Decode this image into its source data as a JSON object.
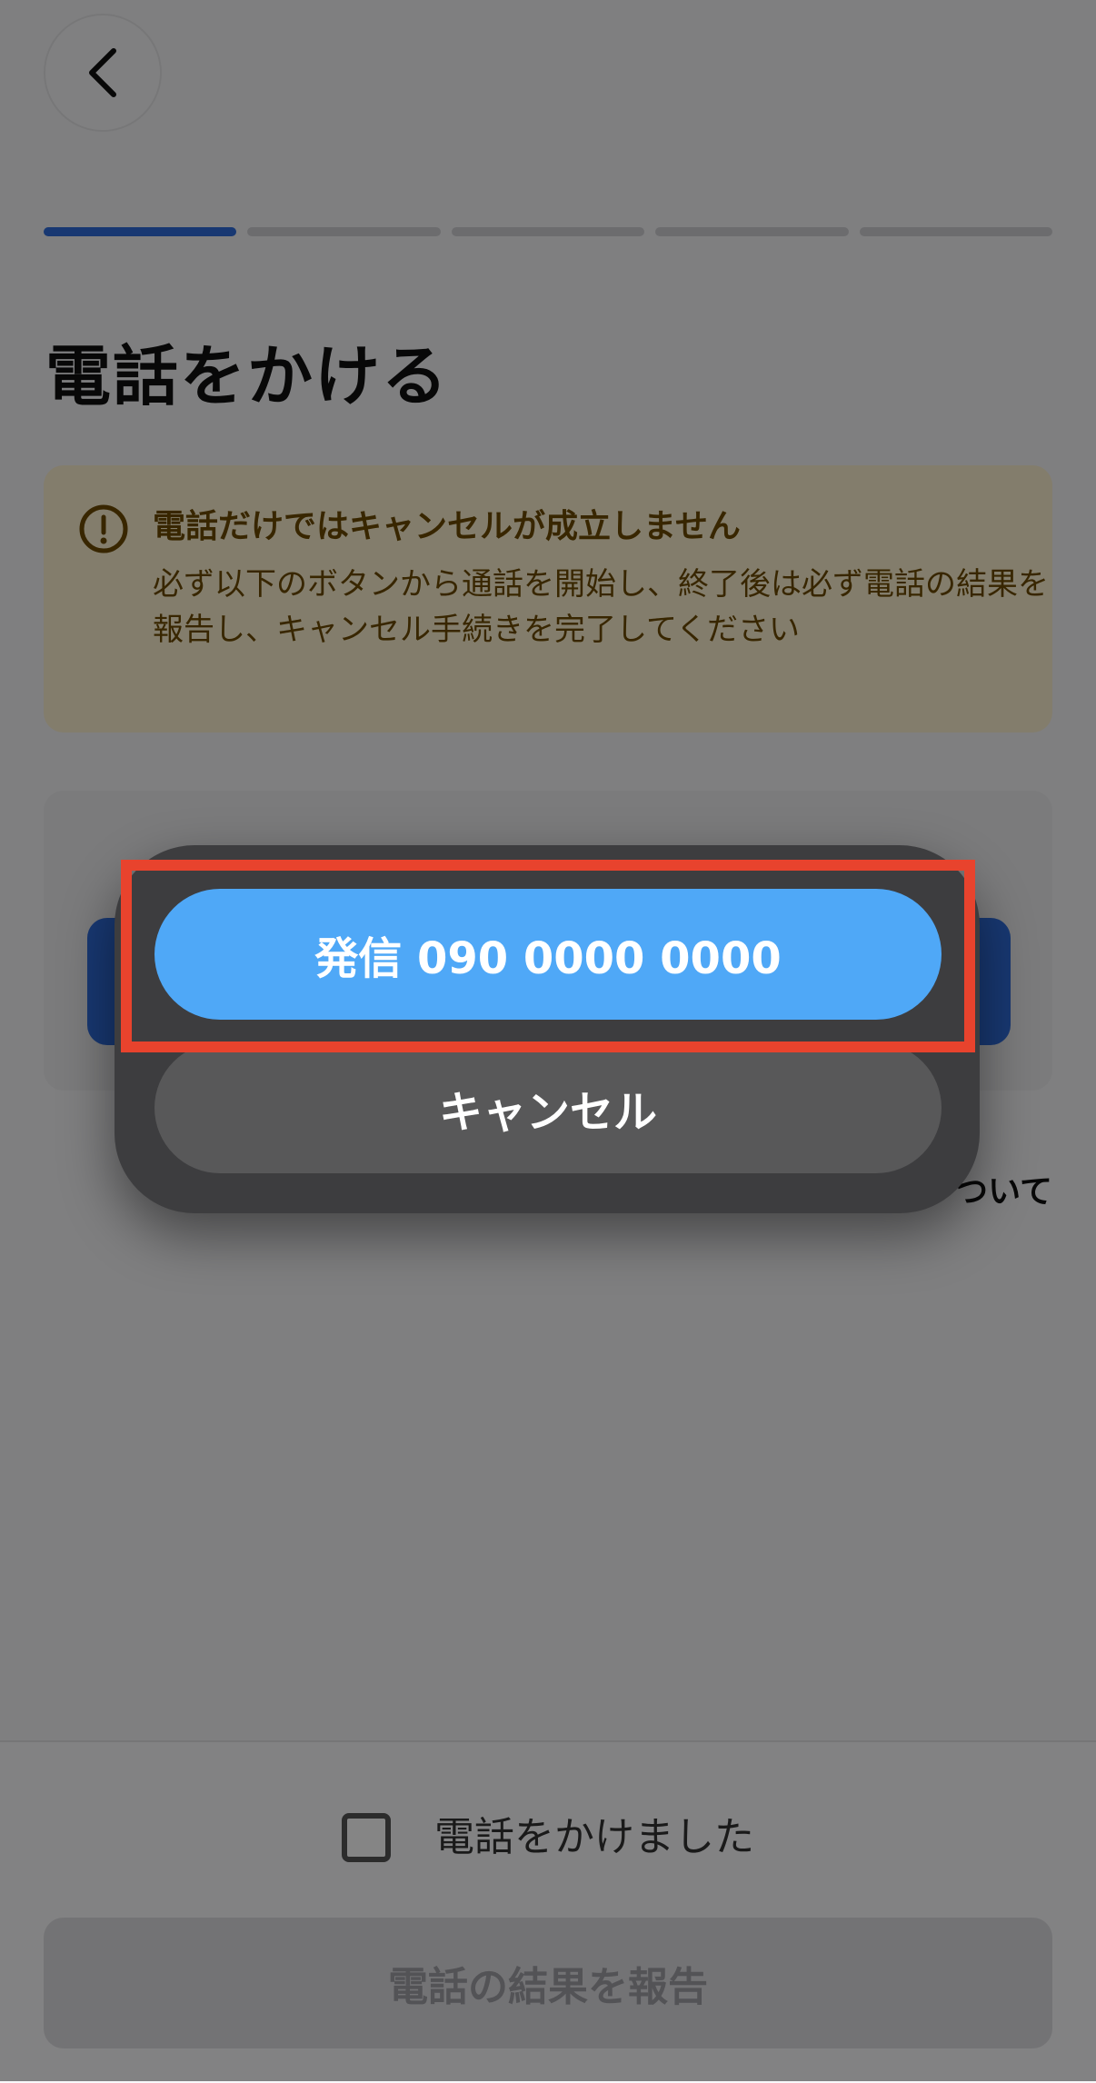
{
  "header": {
    "back_icon": "chevron-left-icon"
  },
  "progress": {
    "total_steps": 5,
    "current_step": 1,
    "active_color": "#2f6bda"
  },
  "page": {
    "title": "電話をかける"
  },
  "warning": {
    "icon": "exclamation-circle-icon",
    "title": "電話だけではキャンセルが成立しません",
    "body": "必ず以下のボタンから通話を開始し、終了後は必ず電話の結果を報告し、キャンセル手続きを完了してください",
    "color": "#6b4a00",
    "background": "#fcefcf"
  },
  "footer": {
    "checkbox_label": "電話をかけました",
    "checkbox_checked": false,
    "report_button": "電話の結果を報告"
  },
  "call_sheet": {
    "call_button": "発信 090 0000 0000",
    "cancel_button": "キャンセル",
    "call_color": "#4fa8f7"
  },
  "highlight_color": "#e8432d"
}
